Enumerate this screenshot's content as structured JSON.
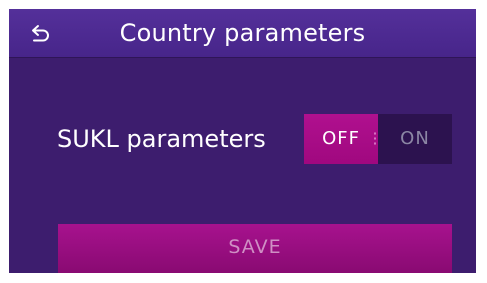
{
  "header": {
    "title": "Country parameters",
    "back_icon": "back-arrow-icon"
  },
  "setting": {
    "label": "SUKL parameters",
    "toggle": {
      "off_label": "OFF",
      "on_label": "ON",
      "selected": "OFF"
    }
  },
  "actions": {
    "save_label": "SAVE"
  },
  "colors": {
    "background": "#3d1d6e",
    "header": "#4c2a8f",
    "accent": "#a80d88",
    "toggle_inactive": "#2c124f"
  }
}
